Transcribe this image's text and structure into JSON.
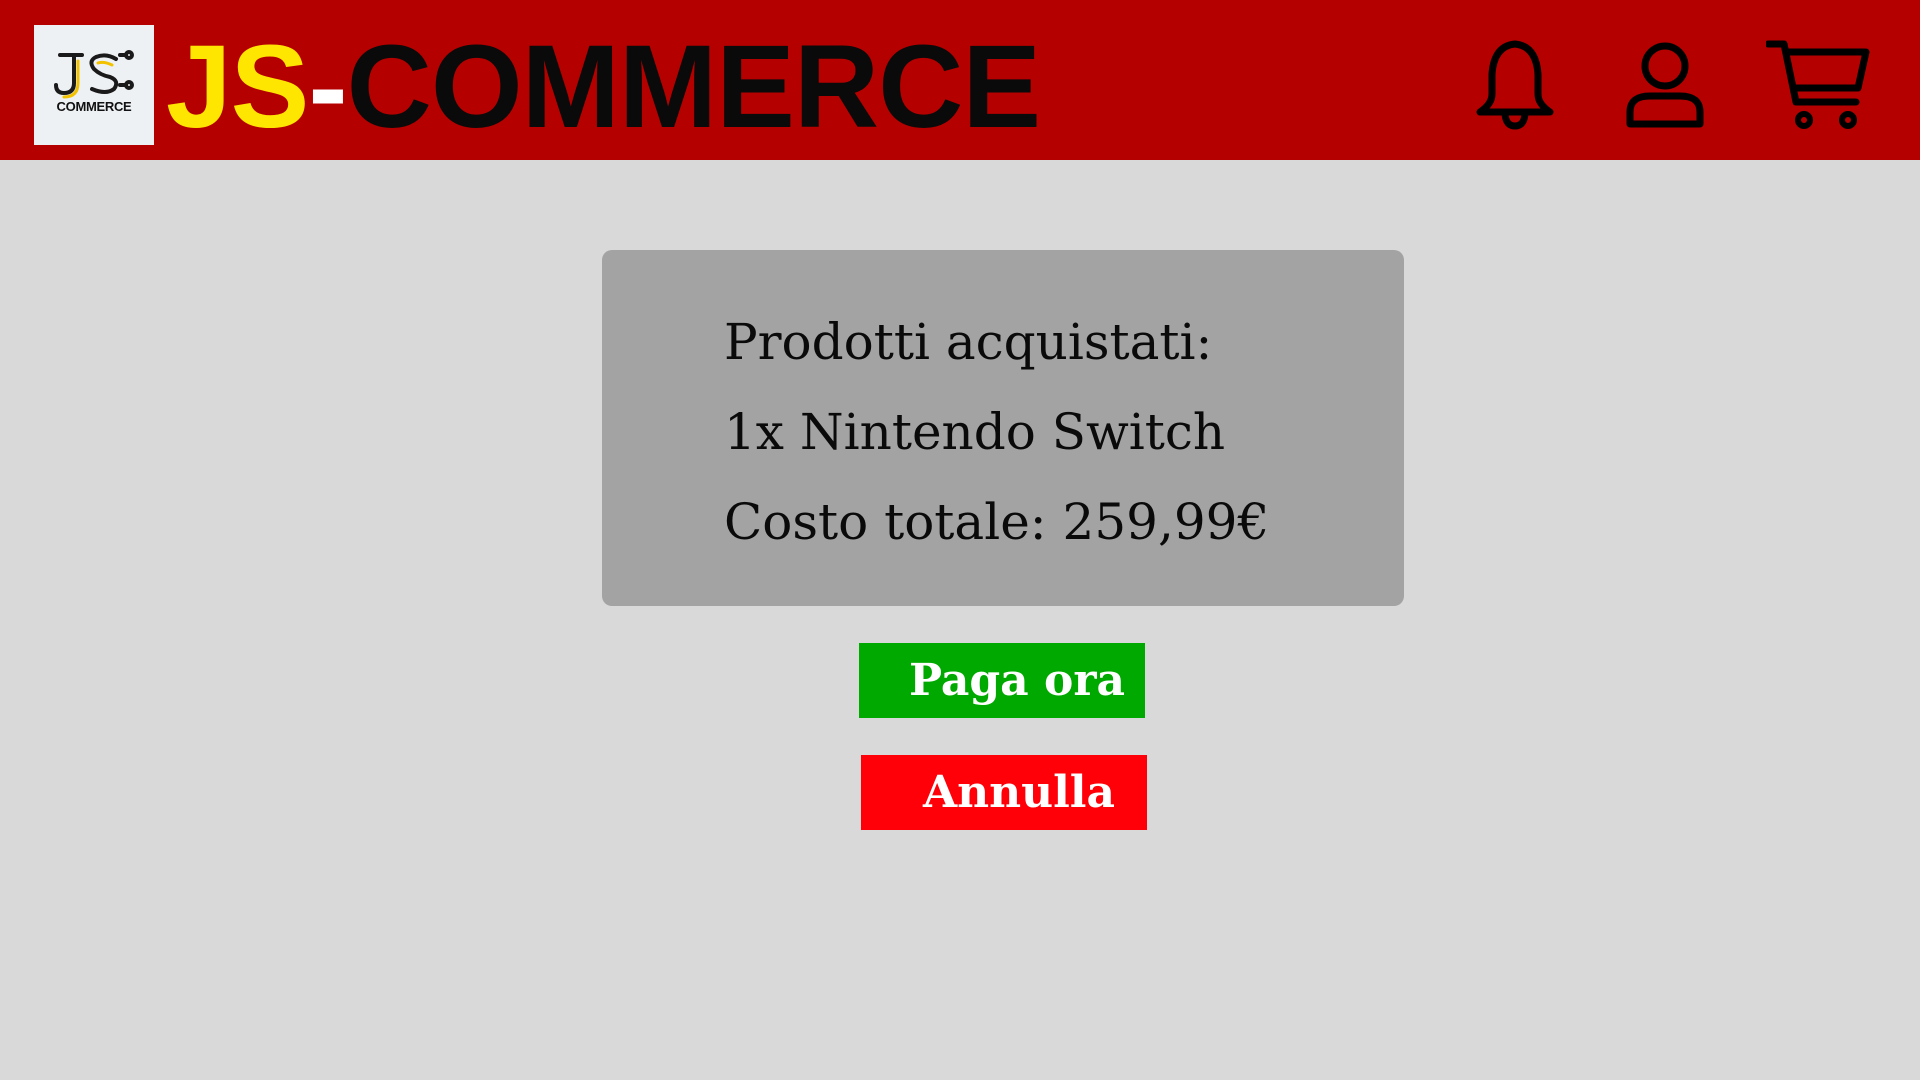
{
  "header": {
    "logo_text": "JS",
    "logo_caption": "COMMERCE",
    "brand_js": "JS",
    "brand_dash": "-",
    "brand_rest": "COMMERCE",
    "background_color": "#b50000",
    "icons": [
      "bell-icon",
      "user-icon",
      "cart-icon"
    ]
  },
  "summary": {
    "heading": "Prodotti acquistati:",
    "item": "1x Nintendo Switch",
    "total": "Costo totale: 259,99€"
  },
  "actions": {
    "pay_label": "Paga ora",
    "pay_color": "#00a900",
    "cancel_label": "Annulla",
    "cancel_color": "#ff0009"
  }
}
